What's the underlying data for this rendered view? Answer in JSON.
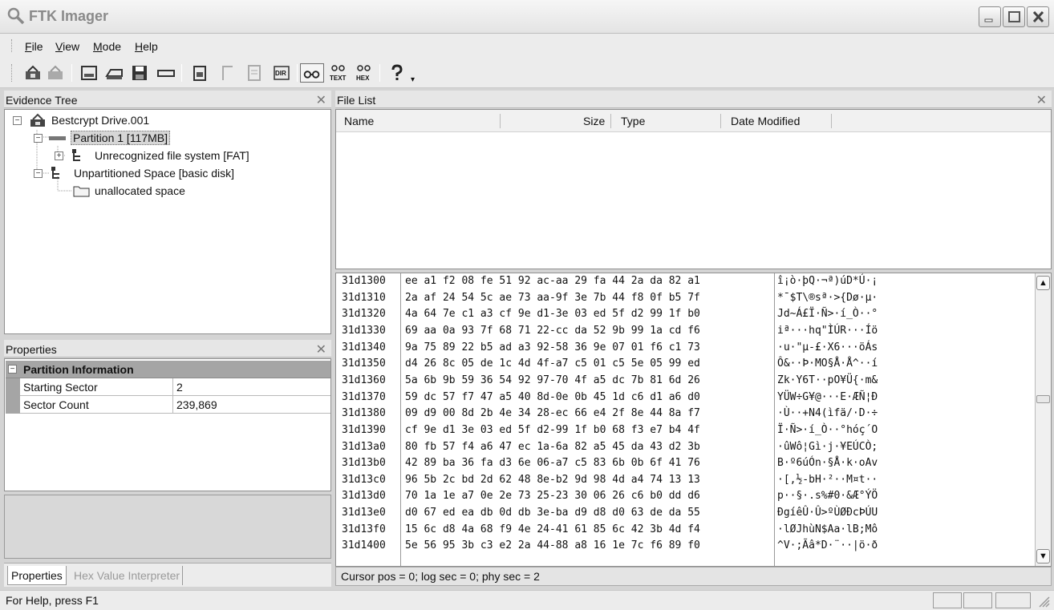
{
  "window": {
    "title": "FTK Imager"
  },
  "menu": {
    "items": [
      {
        "key": "F",
        "rest": "ile"
      },
      {
        "key": "V",
        "rest": "iew"
      },
      {
        "key": "M",
        "rest": "ode"
      },
      {
        "key": "H",
        "rest": "elp"
      }
    ]
  },
  "toolbar": {
    "text_label": "TEXT",
    "hex_label": "HEX",
    "dir_label": "DIR"
  },
  "evidence_tree": {
    "title": "Evidence Tree",
    "items": [
      {
        "label": "Bestcrypt Drive.001"
      },
      {
        "label": "Partition 1 [117MB]"
      },
      {
        "label": "Unrecognized file system [FAT]"
      },
      {
        "label": "Unpartitioned Space [basic disk]"
      },
      {
        "label": "unallocated space"
      }
    ]
  },
  "properties": {
    "title": "Properties",
    "group": "Partition Information",
    "rows": [
      {
        "key": "Starting Sector",
        "value": "2"
      },
      {
        "key": "Sector Count",
        "value": "239,869"
      }
    ],
    "tabs": [
      "Properties",
      "Hex Value Interpreter"
    ]
  },
  "file_list": {
    "title": "File List",
    "columns": [
      "Name",
      "Size",
      "Type",
      "Date Modified"
    ]
  },
  "hex_view": {
    "rows": [
      {
        "offset": "31d1300",
        "bytes": "ee a1 f2 08 fe 51 92 ac-aa 29 fa 44 2a da 82 a1",
        "ascii": "î¡ò·þQ·¬ª)úD*Ú·¡"
      },
      {
        "offset": "31d1310",
        "bytes": "2a af 24 54 5c ae 73 aa-9f 3e 7b 44 f8 0f b5 7f",
        "ascii": "*¯$T\\®sª·>{Dø·µ·"
      },
      {
        "offset": "31d1320",
        "bytes": "4a 64 7e c1 a3 cf 9e d1-3e 03 ed 5f d2 99 1f b0",
        "ascii": "Jd~Á£Ï·Ñ>·í_Ò··°"
      },
      {
        "offset": "31d1330",
        "bytes": "69 aa 0a 93 7f 68 71 22-cc da 52 9b 99 1a cd f6",
        "ascii": "iª···hq\"ÌÚR···Íö"
      },
      {
        "offset": "31d1340",
        "bytes": "9a 75 89 22 b5 ad a3 92-58 36 9e 07 01 f6 c1 73",
        "ascii": "·u·\"µ-£·X6···öÁs"
      },
      {
        "offset": "31d1350",
        "bytes": "d4 26 8c 05 de 1c 4d 4f-a7 c5 01 c5 5e 05 99 ed",
        "ascii": "Ô&··Þ·MO§Å·Å^··í"
      },
      {
        "offset": "31d1360",
        "bytes": "5a 6b 9b 59 36 54 92 97-70 4f a5 dc 7b 81 6d 26",
        "ascii": "Zk·Y6T··pO¥Ü{·m&"
      },
      {
        "offset": "31d1370",
        "bytes": "59 dc 57 f7 47 a5 40 8d-0e 0b 45 1d c6 d1 a6 d0",
        "ascii": "YÜW÷G¥@···E·ÆÑ¦Ð"
      },
      {
        "offset": "31d1380",
        "bytes": "09 d9 00 8d 2b 4e 34 28-ec 66 e4 2f 8e 44 8a f7",
        "ascii": "·Ù··+N4(ìfä/·D·÷"
      },
      {
        "offset": "31d1390",
        "bytes": "cf 9e d1 3e 03 ed 5f d2-99 1f b0 68 f3 e7 b4 4f",
        "ascii": "Ï·Ñ>·í_Ò··°hóç´O"
      },
      {
        "offset": "31d13a0",
        "bytes": "80 fb 57 f4 a6 47 ec 1a-6a 82 a5 45 da 43 d2 3b",
        "ascii": "·ûWô¦Gì·j·¥EÚCÒ;"
      },
      {
        "offset": "31d13b0",
        "bytes": "42 89 ba 36 fa d3 6e 06-a7 c5 83 6b 0b 6f 41 76",
        "ascii": "B·º6úÓn·§Å·k·oAv"
      },
      {
        "offset": "31d13c0",
        "bytes": "96 5b 2c bd 2d 62 48 8e-b2 9d 98 4d a4 74 13 13",
        "ascii": "·[,½-bH·²··M¤t··"
      },
      {
        "offset": "31d13d0",
        "bytes": "70 1a 1e a7 0e 2e 73 25-23 30 06 26 c6 b0 dd d6",
        "ascii": "p··§·.s%#0·&Æ°ÝÖ"
      },
      {
        "offset": "31d13e0",
        "bytes": "d0 67 ed ea db 0d db 3e-ba d9 d8 d0 63 de da 55",
        "ascii": "ÐgíêÛ·Û>ºÙØÐcÞÚU"
      },
      {
        "offset": "31d13f0",
        "bytes": "15 6c d8 4a 68 f9 4e 24-41 61 85 6c 42 3b 4d f4",
        "ascii": "·lØJhùN$Aa·lB;Mô"
      },
      {
        "offset": "31d1400",
        "bytes": "5e 56 95 3b c3 e2 2a 44-88 a8 16 1e 7c f6 89 f0",
        "ascii": "^V·;Ãâ*D·¨··|ö·ð"
      }
    ]
  },
  "hex_status": "Cursor pos = 0; log sec = 0; phy sec = 2",
  "status_bar": {
    "help": "For Help, press F1"
  },
  "colors": {
    "selected_group": "#a5a5a5",
    "panel_header": "#e6e6e6"
  }
}
